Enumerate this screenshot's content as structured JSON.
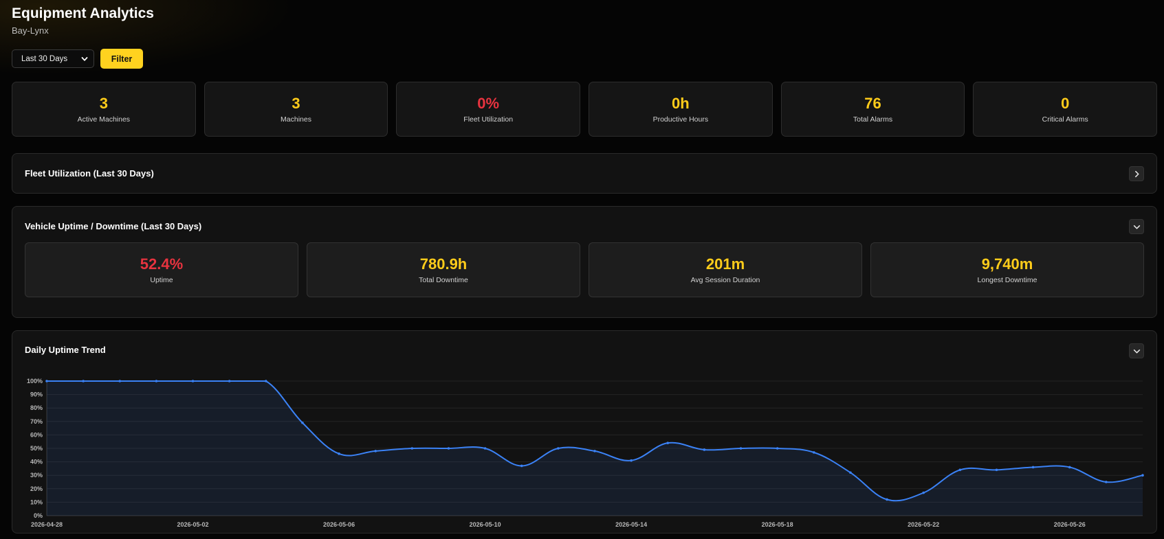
{
  "header": {
    "title": "Equipment Analytics",
    "subtitle": "Bay-Lynx"
  },
  "controls": {
    "range_selected": "Last 30 Days",
    "filter_label": "Filter"
  },
  "stats": [
    {
      "value": "3",
      "label": "Active Machines",
      "color": "#ffcc1a"
    },
    {
      "value": "3",
      "label": "Machines",
      "color": "#ffcc1a"
    },
    {
      "value": "0%",
      "label": "Fleet Utilization",
      "color": "#e8333f"
    },
    {
      "value": "0h",
      "label": "Productive Hours",
      "color": "#ffcc1a"
    },
    {
      "value": "76",
      "label": "Total Alarms",
      "color": "#ffcc1a"
    },
    {
      "value": "0",
      "label": "Critical Alarms",
      "color": "#ffcc1a"
    }
  ],
  "fleet_panel": {
    "title": "Fleet Utilization (Last 30 Days)",
    "toggle_icon": "chevron-right-icon"
  },
  "uptime_panel": {
    "title": "Vehicle Uptime / Downtime (Last 30 Days)",
    "toggle_icon": "chevron-down-icon",
    "stats": [
      {
        "value": "52.4%",
        "label": "Uptime",
        "color": "#e8333f"
      },
      {
        "value": "780.9h",
        "label": "Total Downtime",
        "color": "#ffcc1a"
      },
      {
        "value": "201m",
        "label": "Avg Session Duration",
        "color": "#ffcc1a"
      },
      {
        "value": "9,740m",
        "label": "Longest Downtime",
        "color": "#ffcc1a"
      }
    ]
  },
  "trend_panel": {
    "title": "Daily Uptime Trend",
    "toggle_icon": "chevron-down-icon"
  },
  "chart_data": {
    "type": "area",
    "title": "Daily Uptime Trend",
    "xlabel": "",
    "ylabel": "",
    "x": [
      "2026-04-28",
      "2026-04-29",
      "2026-04-30",
      "2026-05-01",
      "2026-05-02",
      "2026-05-03",
      "2026-05-04",
      "2026-05-05",
      "2026-05-06",
      "2026-05-07",
      "2026-05-08",
      "2026-05-09",
      "2026-05-10",
      "2026-05-11",
      "2026-05-12",
      "2026-05-13",
      "2026-05-14",
      "2026-05-15",
      "2026-05-16",
      "2026-05-17",
      "2026-05-18",
      "2026-05-19",
      "2026-05-20",
      "2026-05-21",
      "2026-05-22",
      "2026-05-23",
      "2026-05-24",
      "2026-05-25",
      "2026-05-26",
      "2026-05-27",
      "2026-05-28"
    ],
    "x_tick_labels": [
      "2026-04-28",
      "2026-05-02",
      "2026-05-06",
      "2026-05-10",
      "2026-05-14",
      "2026-05-18",
      "2026-05-22",
      "2026-05-26"
    ],
    "values": [
      100,
      100,
      100,
      100,
      100,
      100,
      100,
      69,
      46,
      48,
      50,
      50,
      50,
      37,
      50,
      48,
      41,
      54,
      49,
      50,
      50,
      47,
      32,
      12,
      17,
      34,
      34,
      36,
      36,
      25,
      30
    ],
    "ylim": [
      0,
      100
    ],
    "y_ticks": [
      "0%",
      "10%",
      "20%",
      "30%",
      "40%",
      "50%",
      "60%",
      "70%",
      "80%",
      "90%",
      "100%"
    ],
    "line_color": "#3b82f6",
    "grid": true,
    "legend": "none"
  }
}
